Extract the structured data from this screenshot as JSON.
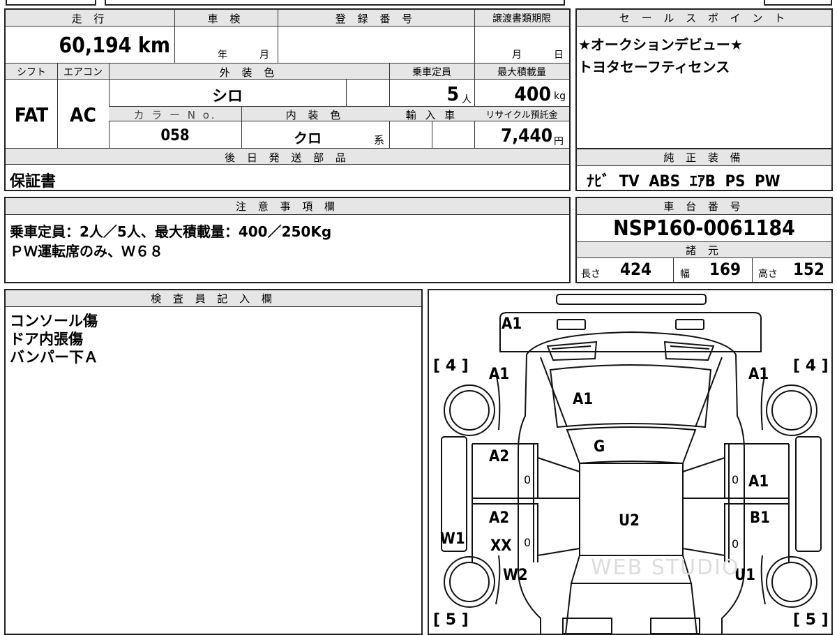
{
  "vehicle": {
    "mileage_label": "走 行",
    "mileage_value": "60,194",
    "mileage_unit": "km",
    "inspection_label": "車 検",
    "inspection_year_unit": "年",
    "inspection_month_unit": "月",
    "registration_label": "登 録 番 号",
    "registration_value": "",
    "transfer_deadline_label": "譲渡書類期限",
    "transfer_month_unit": "月",
    "transfer_day_unit": "日",
    "shift_label": "シフト",
    "shift_value": "FAT",
    "ac_label": "エアコン",
    "ac_value": "AC",
    "exterior_color_label": "外 装 色",
    "exterior_color_value": "シロ",
    "capacity_label": "乗車定員",
    "capacity_value": "5",
    "capacity_unit": "人",
    "max_load_label": "最大積載量",
    "max_load_value": "400",
    "max_load_unit": "kg",
    "color_no_label": "カ ラ ー N o.",
    "color_no_value": "058",
    "interior_color_label": "内 装 色",
    "interior_color_value": "クロ",
    "interior_color_suffix": "系",
    "import_label": "輸 入 車",
    "recycle_label": "リサイクル預託金",
    "recycle_value": "7,440",
    "recycle_unit": "円",
    "later_parts_label": "後 日 発 送 部 品",
    "later_parts_value": "保証書"
  },
  "sales_points": {
    "label": "セ ー ル ス ポ イ ン ト",
    "lines": [
      "★オークションデビュー★",
      "トヨタセーフティセンス"
    ]
  },
  "genuine_equipment": {
    "label": "純 正 装 備",
    "value": "ﾅﾋﾞ  TV  ABS  ｴｱB  PS  PW"
  },
  "notes": {
    "label": "注 意 事 項 欄",
    "lines": [
      "乗車定員：2人／5人、最大積載量：400／250Kg",
      "ＰＷ運転席のみ、Ｗ６８"
    ]
  },
  "chassis": {
    "label": "車 台 番 号",
    "value": "NSP160-0061184"
  },
  "specs": {
    "label": "諸 元",
    "length_label": "長さ",
    "length_value": "424",
    "width_label": "幅",
    "width_value": "169",
    "height_label": "高さ",
    "height_value": "152"
  },
  "inspector": {
    "label": "検 査 員 記 入 欄",
    "lines": [
      "コンソール傷",
      "ドア内張傷",
      "バンパー下Ａ"
    ]
  },
  "diagram": {
    "tire_front_left": "[ 4 ]",
    "tire_front_right": "[ 4 ]",
    "tire_rear_left": "[ 5 ]",
    "tire_rear_right": "[ 5 ]",
    "marks": {
      "bumper_front": "A1",
      "fender_fl": "A1",
      "fender_fr": "A1",
      "hood": "A1",
      "windshield": "G",
      "door_fl": "A2",
      "door_fr": "A1",
      "door_rl_1": "A2",
      "door_rl_2": "XX",
      "door_rr": "B1",
      "roof": "U2",
      "step_left": "W1",
      "quarter_rl": "W2",
      "quarter_rr": "U1",
      "door_fl_zero": "0",
      "door_fr_zero": "0",
      "door_rl_zero": "0",
      "door_rr_zero": "0"
    },
    "watermark": "WEB STUDIO"
  }
}
